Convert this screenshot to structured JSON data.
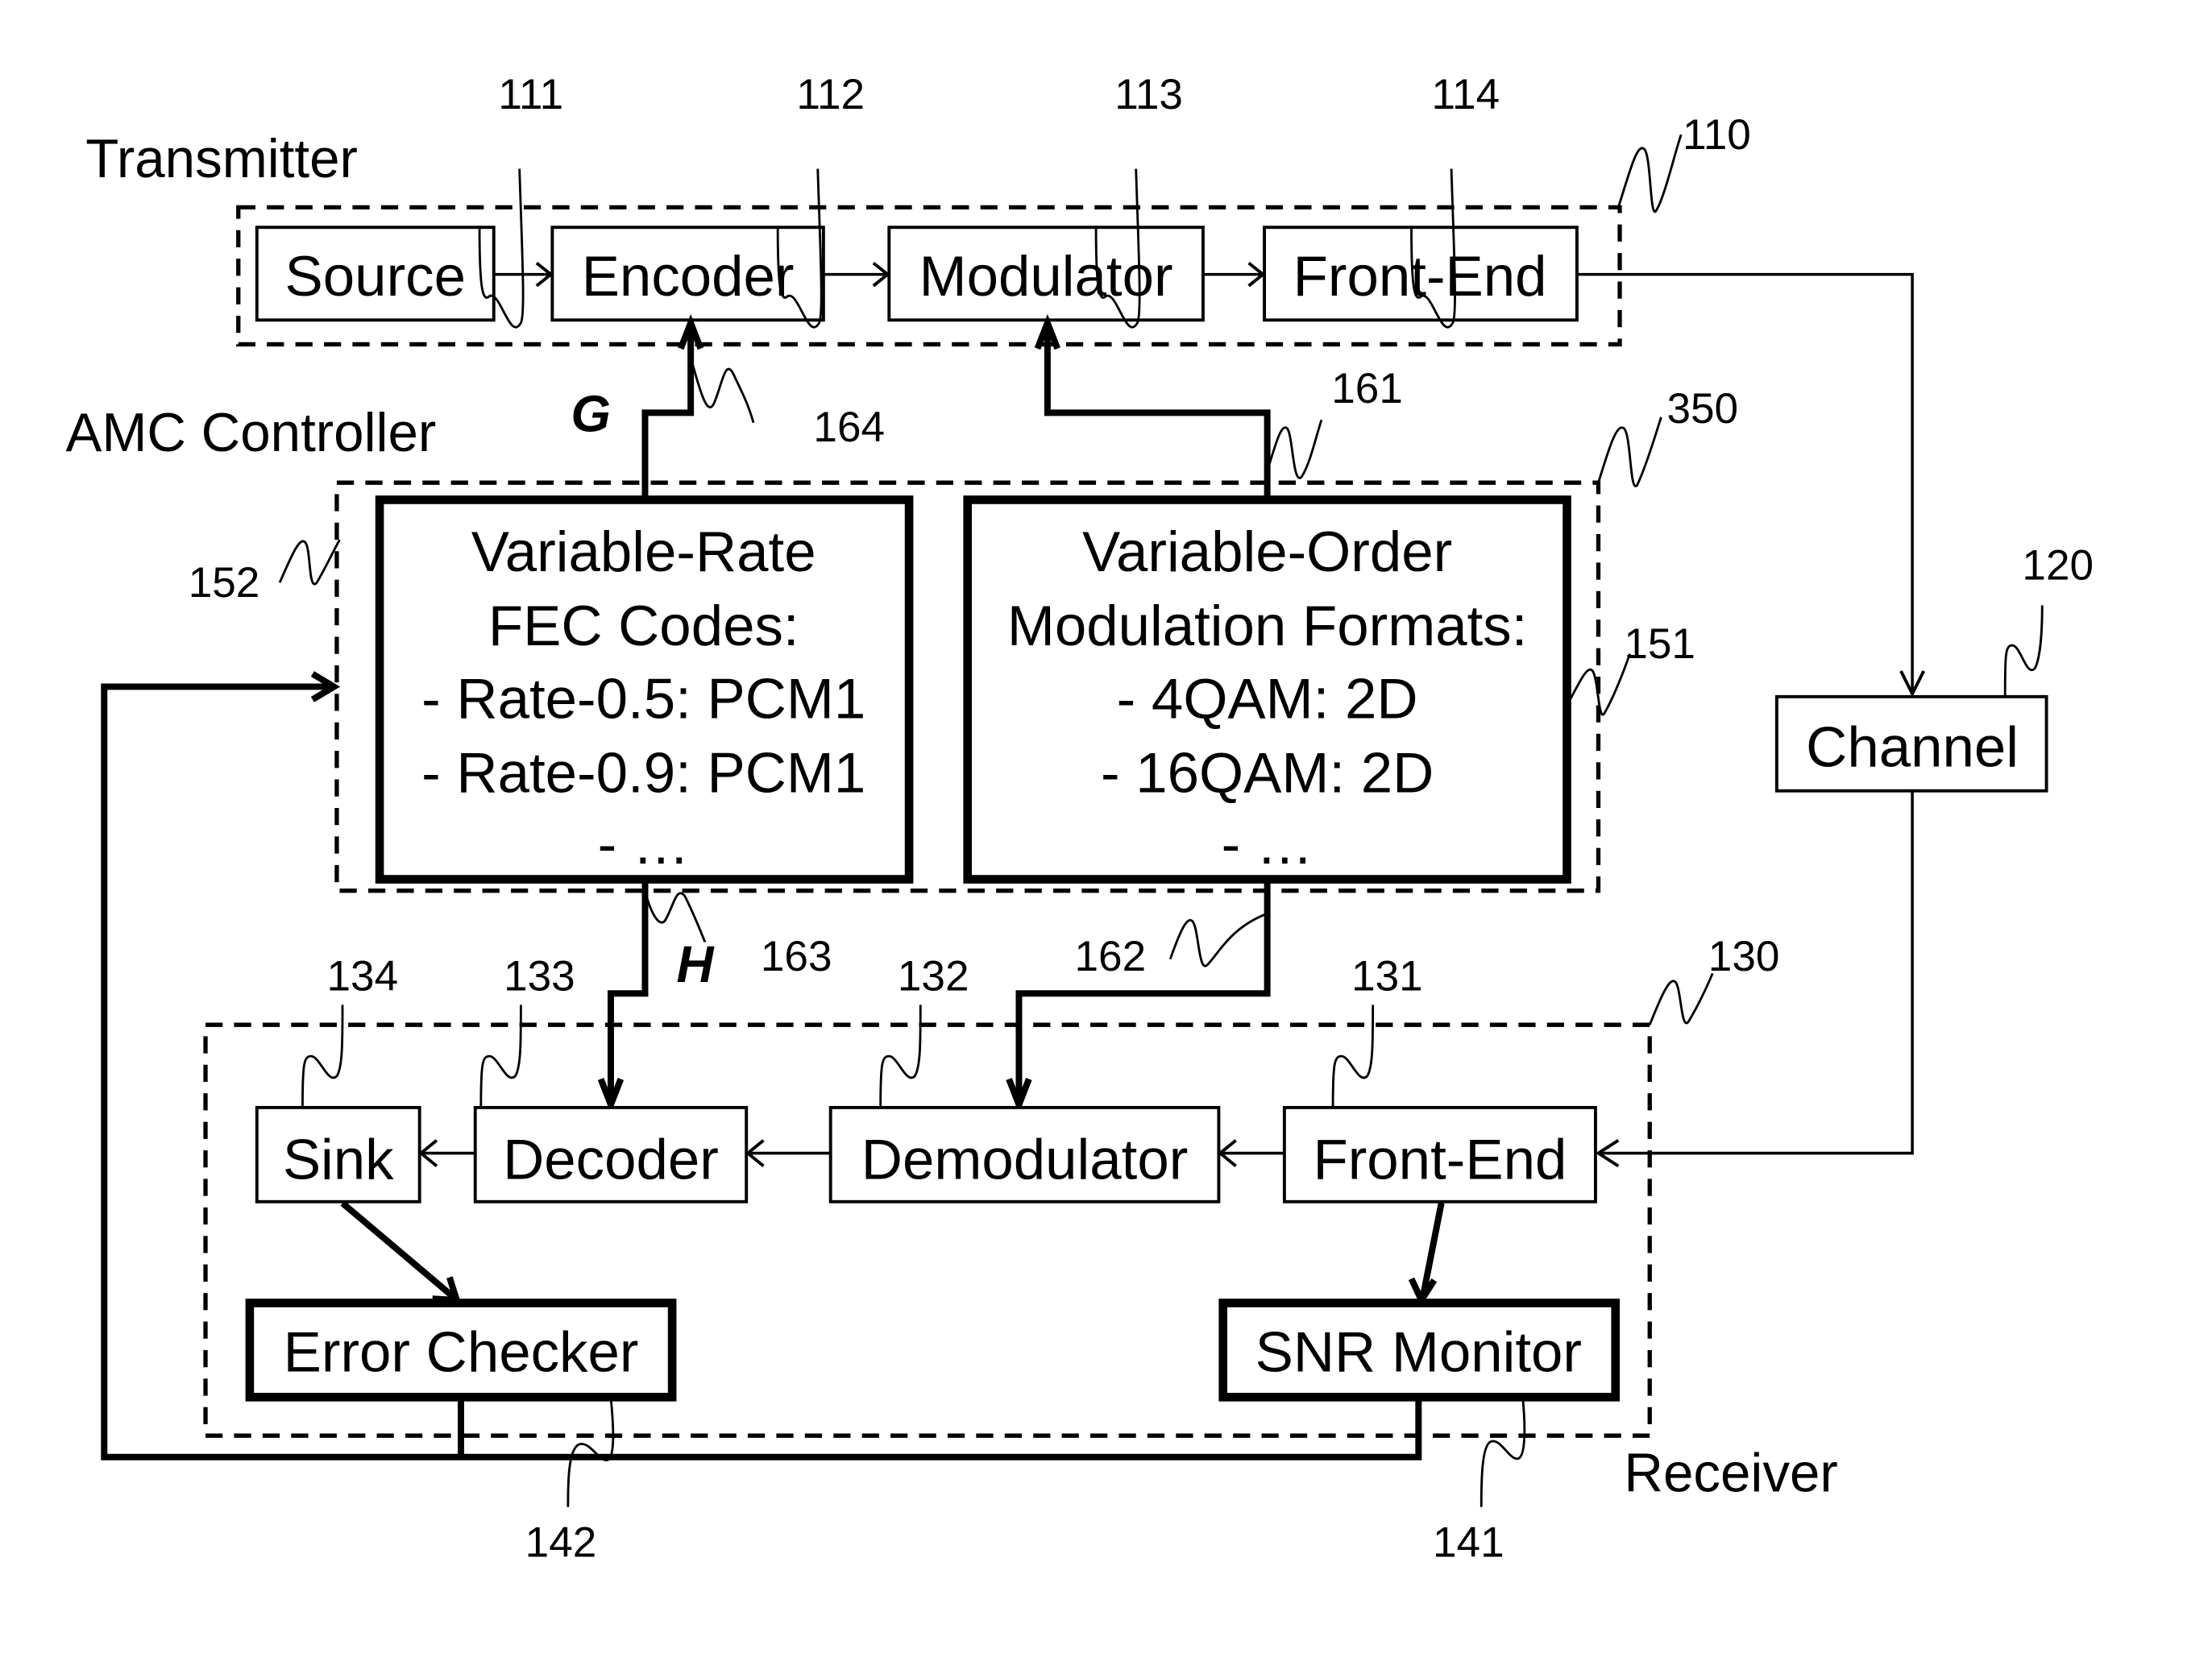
{
  "groups": {
    "transmitter": {
      "label": "Transmitter",
      "ref": "110"
    },
    "amc_controller": {
      "label": "AMC Controller",
      "ref": "350"
    },
    "receiver": {
      "label": "Receiver",
      "ref": "130"
    }
  },
  "transmitter_blocks": {
    "source": {
      "label": "Source",
      "ref": "111"
    },
    "encoder": {
      "label": "Encoder",
      "ref": "112"
    },
    "modulator": {
      "label": "Modulator",
      "ref": "113"
    },
    "front_end": {
      "label": "Front-End",
      "ref": "114"
    }
  },
  "channel": {
    "label": "Channel",
    "ref": "120"
  },
  "fec_block": {
    "ref": "152",
    "lines": [
      "Variable-Rate",
      "FEC Codes:",
      "- Rate-0.5: PCM1",
      "- Rate-0.9: PCM1",
      "- …"
    ]
  },
  "mod_block": {
    "ref": "151",
    "lines": [
      "Variable-Order",
      "Modulation Formats:",
      "- 4QAM: 2D",
      "- 16QAM: 2D",
      "- …"
    ]
  },
  "receiver_blocks": {
    "sink": {
      "label": "Sink",
      "ref": "134"
    },
    "decoder": {
      "label": "Decoder",
      "ref": "133"
    },
    "demodulator": {
      "label": "Demodulator",
      "ref": "132"
    },
    "front_end": {
      "label": "Front-End",
      "ref": "131"
    },
    "error_checker": {
      "label": "Error Checker",
      "ref": "142"
    },
    "snr_monitor": {
      "label": "SNR Monitor",
      "ref": "141"
    }
  },
  "signals": {
    "g": {
      "label": "G",
      "ref": "164"
    },
    "h": {
      "label": "H",
      "ref": "163"
    },
    "mod_to_tx": {
      "ref": "161"
    },
    "mod_to_rx": {
      "ref": "162"
    }
  }
}
